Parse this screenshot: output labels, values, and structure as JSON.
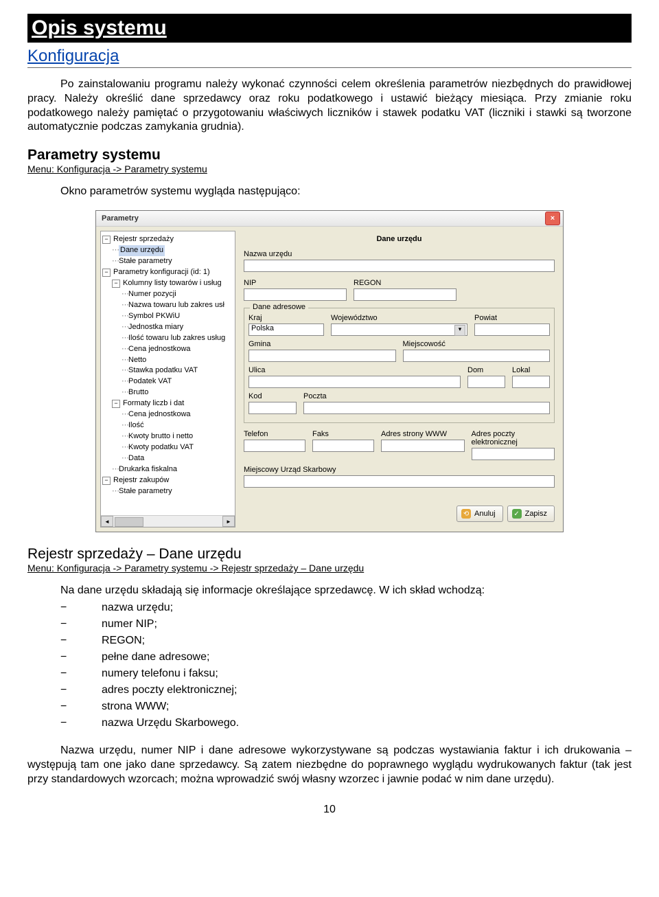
{
  "heading": "Opis systemu",
  "section1_title": "Konfiguracja",
  "para1": "Po zainstalowaniu programu należy wykonać czynności celem określenia parametrów niezbędnych do prawidłowej pracy. Należy określić dane sprzedawcy oraz roku podatkowego i ustawić bieżący miesiąca. Przy zmianie roku podatkowego należy pamiętać o przygotowaniu właściwych liczników i stawek podatku VAT (liczniki i stawki są tworzone automatycznie podczas zamykania grudnia).",
  "sub1_title": "Parametry systemu",
  "sub1_menu": "Menu: Konfiguracja -> Parametry systemu",
  "sub1_intro": "Okno parametrów systemu wygląda następująco:",
  "dialog": {
    "title": "Parametry",
    "close_glyph": "×",
    "panel_title": "Dane urzędu",
    "tree": {
      "n0": "Rejestr sprzedaży",
      "n0a": "Dane urzędu",
      "n0b": "Stałe parametry",
      "n1": "Parametry konfiguracji (id: 1)",
      "n1a": "Kolumny listy towarów i usług",
      "n1a1": "Numer pozycji",
      "n1a2": "Nazwa towaru lub zakres usł",
      "n1a3": "Symbol PKWiU",
      "n1a4": "Jednostka miary",
      "n1a5": "Ilość towaru lub zakres usług",
      "n1a6": "Cena jednostkowa",
      "n1a7": "Netto",
      "n1a8": "Stawka podatku VAT",
      "n1a9": "Podatek VAT",
      "n1a10": "Brutto",
      "n1b": "Formaty liczb i dat",
      "n1b1": "Cena jednostkowa",
      "n1b2": "Ilość",
      "n1b3": "Kwoty brutto i netto",
      "n1b4": "Kwoty podatku VAT",
      "n1b5": "Data",
      "n1c": "Drukarka fiskalna",
      "n2": "Rejestr zakupów",
      "n2a": "Stałe parametry"
    },
    "labels": {
      "nazwa": "Nazwa urzędu",
      "nip": "NIP",
      "regon": "REGON",
      "adres_group": "Dane adresowe",
      "kraj": "Kraj",
      "woj": "Województwo",
      "powiat": "Powiat",
      "gmina": "Gmina",
      "miejsc": "Miejscowość",
      "ulica": "Ulica",
      "dom": "Dom",
      "lokal": "Lokal",
      "kod": "Kod",
      "poczta": "Poczta",
      "telefon": "Telefon",
      "faks": "Faks",
      "www": "Adres strony WWW",
      "email": "Adres poczty elektronicznej",
      "urzad": "Miejscowy Urząd Skarbowy"
    },
    "values": {
      "kraj": "Polska"
    },
    "buttons": {
      "cancel": "Anuluj",
      "save": "Zapisz"
    }
  },
  "sub2_title": "Rejestr sprzedaży – Dane urzędu",
  "sub2_menu": "Menu: Konfiguracja -> Parametry systemu -> Rejestr sprzedaży – Dane urzędu",
  "sub2_intro": "Na dane urzędu składają się informacje określające sprzedawcę. W ich skład wchodzą:",
  "bullets": [
    "nazwa urzędu;",
    "numer NIP;",
    "REGON;",
    "pełne dane adresowe;",
    "numery telefonu i faksu;",
    "adres poczty elektronicznej;",
    "strona WWW;",
    "nazwa Urzędu Skarbowego."
  ],
  "para_last": "Nazwa urzędu, numer NIP i dane adresowe wykorzystywane są podczas wystawiania faktur i ich drukowania – występują tam one jako dane sprzedawcy. Są zatem niezbędne do poprawnego wyglądu wydrukowanych faktur (tak jest przy standardowych wzorcach; można wprowadzić swój własny wzorzec i jawnie podać w nim dane urzędu).",
  "page_number": "10",
  "scroll_arrows": {
    "left": "◄",
    "right": "►"
  }
}
